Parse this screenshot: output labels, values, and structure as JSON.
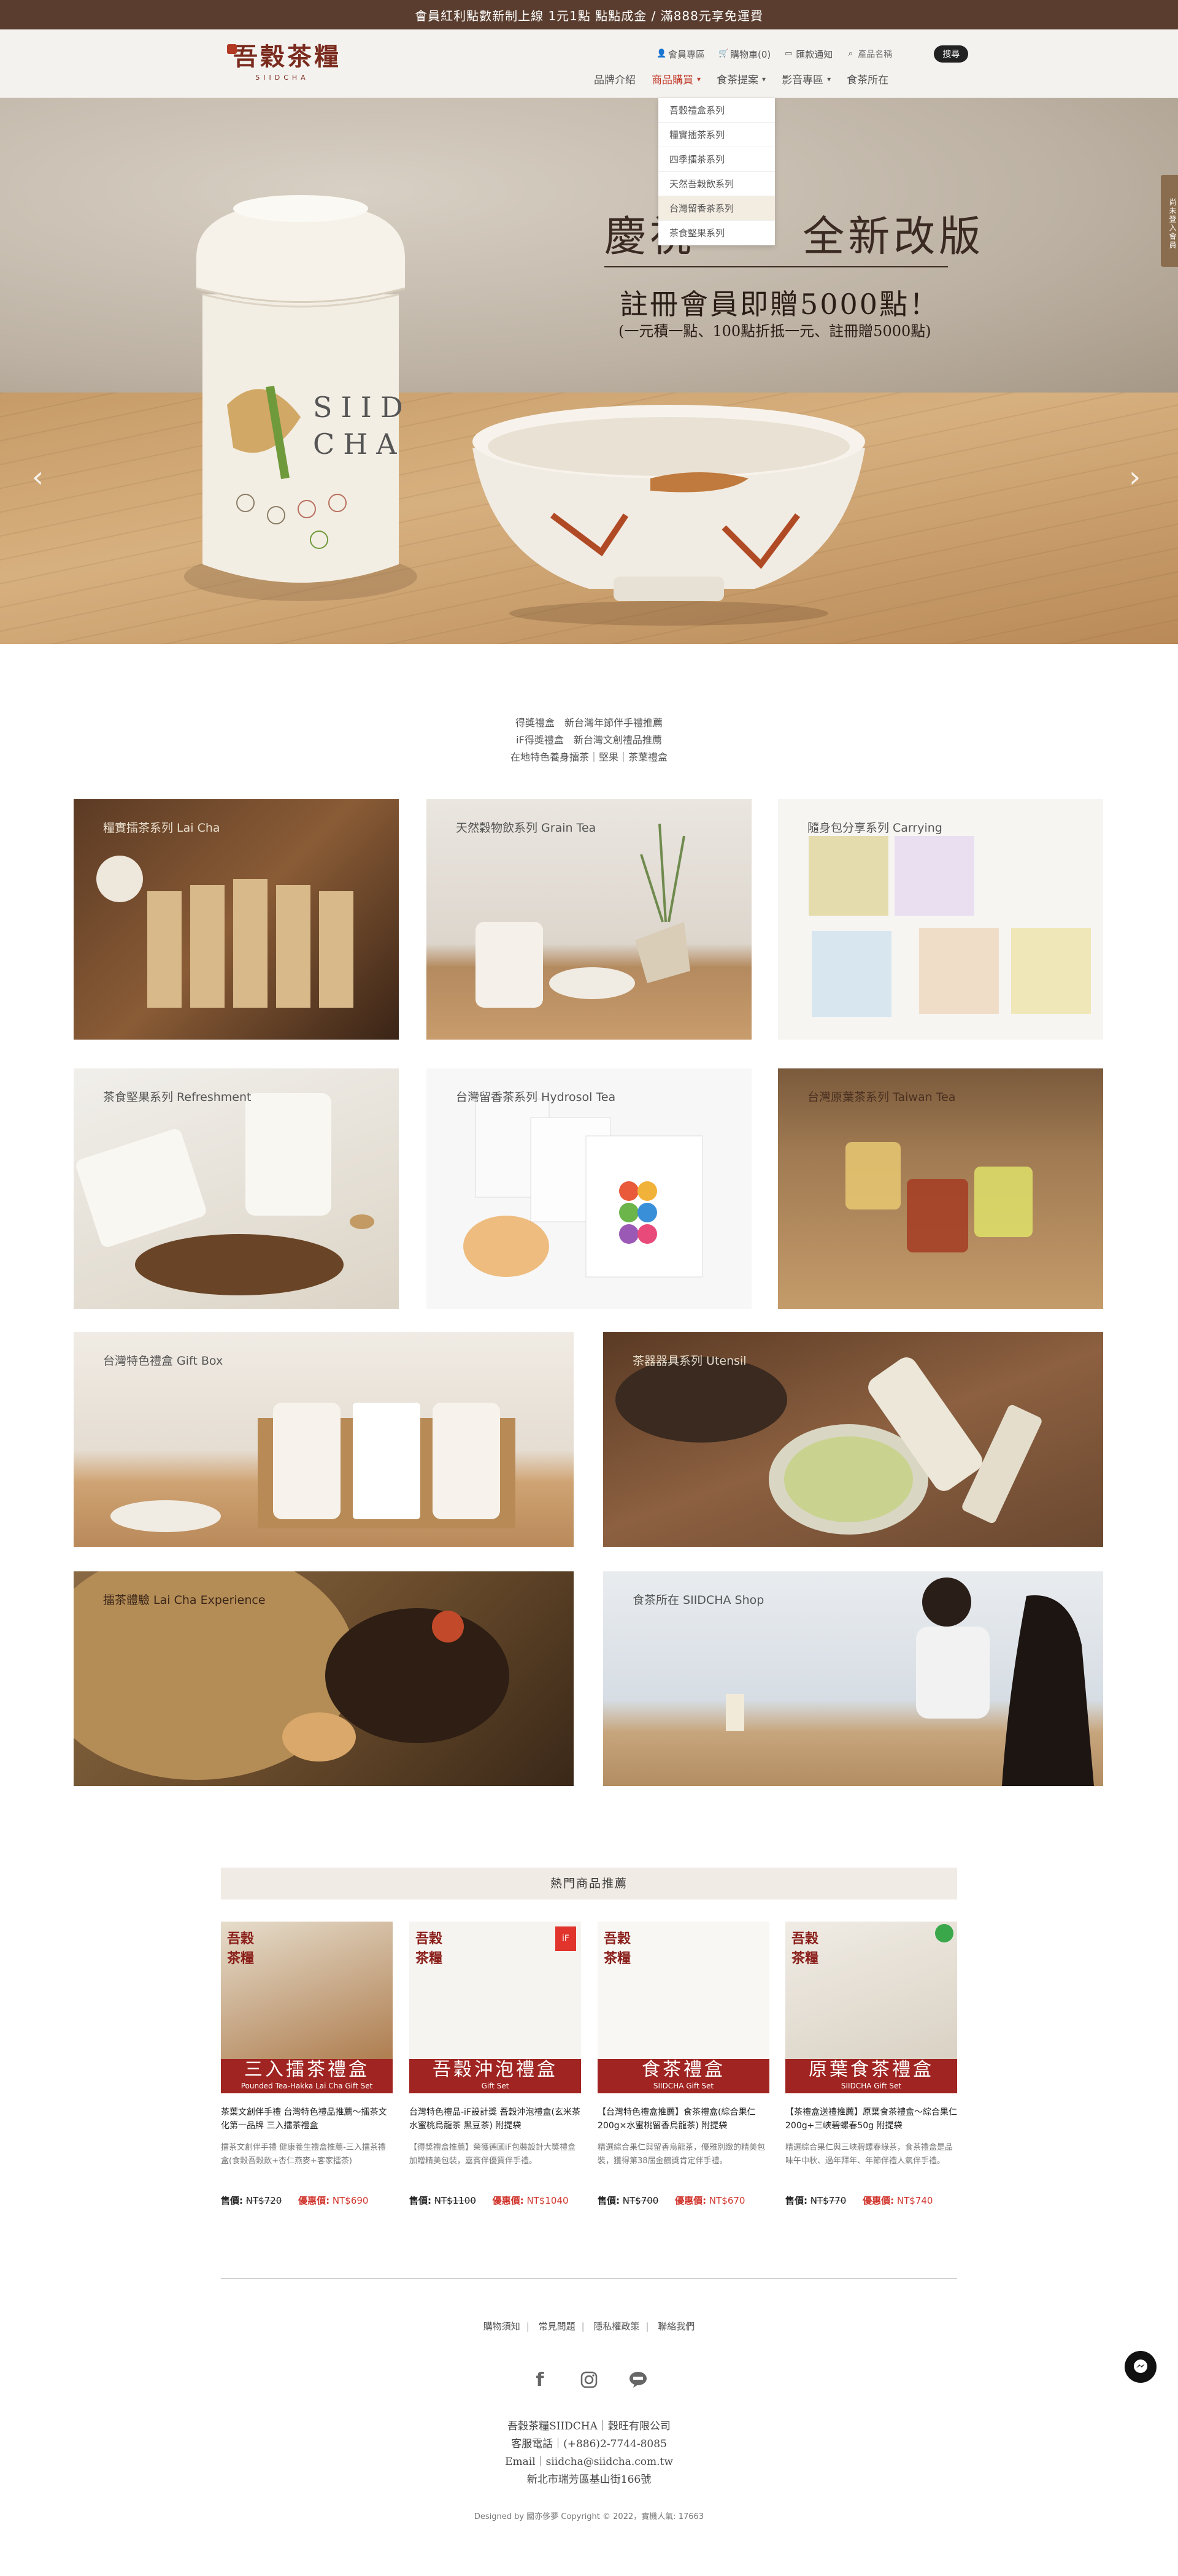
{
  "announcement": "會員紅利點數新制上線 1元1點 點點成金 / 滿888元享免運費",
  "brand": {
    "logo_zh": "吾穀茶糧",
    "logo_en": "SIIDCHA"
  },
  "utility": {
    "member": "會員專區",
    "cart": "購物車(0)",
    "notice": "匯款通知",
    "search_placeholder": "產品名稱",
    "search_button": "搜尋"
  },
  "nav": [
    {
      "label": "品牌介紹"
    },
    {
      "label": "商品購買"
    },
    {
      "label": "食茶提案"
    },
    {
      "label": "影音專區"
    },
    {
      "label": "食茶所在"
    }
  ],
  "dropdown": [
    "吾穀禮盒系列",
    "糧實擂茶系列",
    "四季擂茶系列",
    "天然吾穀飲系列",
    "台灣留香茶系列",
    "茶食堅果系列"
  ],
  "hero": {
    "title_left": "慶祝",
    "title_right": "全新改版",
    "subtitle": "註冊會員即贈5000點！",
    "note": "(一元積一點、100點折抵一元、註冊贈5000點)",
    "side_tab": "尚未登入會員"
  },
  "intro": [
    "得獎禮盒　新台灣年節伴手禮推薦",
    "iF得獎禮盒　新台灣文創禮品推薦",
    "在地特色養身擂茶｜堅果｜茶葉禮盒"
  ],
  "categories": [
    {
      "label": "糧實擂茶系列 Lai Cha"
    },
    {
      "label": "天然穀物飲系列 Grain Tea"
    },
    {
      "label": "隨身包分享系列 Carrying"
    },
    {
      "label": "茶食堅果系列 Refreshment"
    },
    {
      "label": "台灣留香茶系列 Hydrosol Tea"
    },
    {
      "label": "台灣原葉茶系列 Taiwan Tea"
    },
    {
      "label": "台灣特色禮盒 Gift Box"
    },
    {
      "label": "茶器器具系列 Utensil"
    },
    {
      "label": "擂茶體驗 Lai Cha Experience"
    },
    {
      "label": "食茶所在 SIIDCHA Shop"
    }
  ],
  "hot_title": "熱門商品推薦",
  "products": [
    {
      "band_title": "三入擂茶禮盒",
      "band_sub": "Pounded Tea-Hakka Lai Cha Gift Set",
      "title": "茶葉文創伴手禮 台灣特色禮品推薦～擂茶文化第一品牌 三入擂茶禮盒",
      "desc": "擂茶文創伴手禮 健康養生禮盒推薦-三入擂茶禮盒(食穀吾穀飲+杏仁燕麥+客家擂茶)",
      "orig_label": "售價:",
      "orig_price": "NT$720",
      "sale_label": "優惠價:",
      "sale_price": "NT$690"
    },
    {
      "band_title": "吾穀沖泡禮盒",
      "band_sub": "Gift Set",
      "title": "台灣特色禮品-iF設計獎 吾穀沖泡禮盒(玄米茶 水蜜桃烏龍茶 黑豆茶) 附提袋",
      "desc": "【得獎禮盒推薦】榮獲德國iF包裝設計大獎禮盒加贈精美包裝，嘉賓伴優質伴手禮。",
      "orig_label": "售價:",
      "orig_price": "NT$1100",
      "sale_label": "優惠價:",
      "sale_price": "NT$1040"
    },
    {
      "band_title": "食茶禮盒",
      "band_sub": "SIIDCHA Gift Set",
      "title": "【台灣特色禮盒推薦】食茶禮盒(綜合果仁200g×水蜜桃留香烏龍茶) 附提袋",
      "desc": "精選綜合果仁與留香烏龍茶，優雅別緻的精美包裝，獲得第38屆金鶴獎肯定伴手禮。",
      "orig_label": "售價:",
      "orig_price": "NT$700",
      "sale_label": "優惠價:",
      "sale_price": "NT$670"
    },
    {
      "band_title": "原葉食茶禮盒",
      "band_sub": "SIIDCHA Gift Set",
      "title": "【茶禮盒送禮推薦】原葉食茶禮盒～綜合果仁200g+三峽碧螺春50g 附提袋",
      "desc": "精選綜合果仁與三峽碧螺春綠茶，食茶禮盒是品味午中秋、過年拜年、年節伴禮人氣伴手禮。",
      "orig_label": "售價:",
      "orig_price": "NT$770",
      "sale_label": "優惠價:",
      "sale_price": "NT$740"
    }
  ],
  "footer": {
    "links": [
      "購物須知",
      "常見問題",
      "隱私權政策",
      "聯絡我們"
    ],
    "company": "吾穀茶糧SIIDCHA｜穀旺有限公司",
    "phone": "客服電話｜(+886)2-7744-8085",
    "email": "Email｜siidcha@siidcha.com.tw",
    "address": "新北市瑞芳區基山街166號",
    "copyright": "Designed by 國亦侈夢 Copyright © 2022，實機人氣: 17663"
  },
  "colors": {
    "brand_brown": "#5a3d2e",
    "accent_red": "#c23a2a",
    "sale_red": "#d0342c",
    "band_red": "#a02421"
  }
}
